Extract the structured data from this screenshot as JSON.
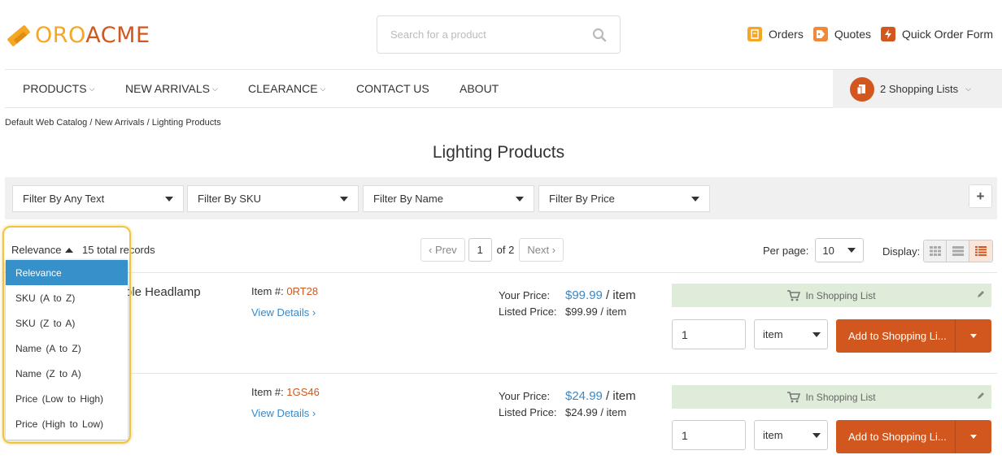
{
  "brand": {
    "part1": "ORO",
    "part2": "ACME",
    "color_orange": "#f5a623",
    "color_red": "#d2571e"
  },
  "search": {
    "placeholder": "Search for a product",
    "icon": "search-icon"
  },
  "top_links": [
    {
      "label": "Orders",
      "icon": "orders-icon",
      "color": "#f5a623"
    },
    {
      "label": "Quotes",
      "icon": "quotes-tag-icon",
      "color": "#f08a3a"
    },
    {
      "label": "Quick Order Form",
      "icon": "lightning-icon",
      "color": "#d2571e"
    }
  ],
  "nav": {
    "items": [
      "PRODUCTS",
      "NEW ARRIVALS",
      "CLEARANCE",
      "CONTACT US",
      "ABOUT"
    ],
    "shopping_lists": "2 Shopping Lists"
  },
  "breadcrumb": "Default Web Catalog / New Arrivals / Lighting Products",
  "page_title": "Lighting Products",
  "filters": [
    "Filter By Any Text",
    "Filter By SKU",
    "Filter By Name",
    "Filter By Price"
  ],
  "toolbar": {
    "sort_label": "Relevance",
    "total": "15 total records",
    "prev": "‹ Prev",
    "page": "1",
    "of_pages": "of 2",
    "next": "Next ›",
    "per_page_label": "Per page:",
    "per_page": "10",
    "display_label": "Display:"
  },
  "sort_options": [
    "Relevance",
    "SKU  (A to Z)",
    "SKU  (Z to A)",
    "Name  (A to Z)",
    "Name  (Z to A)",
    "Price  (Low to High)",
    "Price  (High to Low)"
  ],
  "products": [
    {
      "name_visible": "ble Headlamp",
      "item_label": "Item #: ",
      "sku": "0RT28",
      "details": "View Details ›",
      "your_price_label": "Your Price:",
      "your_price": "$99.99",
      "your_unit": " / item",
      "listed_label": "Listed Price:",
      "listed_price": "$99.99 / item",
      "in_list": "In Shopping List",
      "qty": "1",
      "unit": "item",
      "add_label": "Add to Shopping Li..."
    },
    {
      "name_visible": "",
      "item_label": "Item #: ",
      "sku": "1GS46",
      "details": "View Details ›",
      "your_price_label": "Your Price:",
      "your_price": "$24.99",
      "your_unit": " / item",
      "listed_label": "Listed Price:",
      "listed_price": "$24.99 / item",
      "in_list": "In Shopping List",
      "qty": "1",
      "unit": "item",
      "add_label": "Add to Shopping Li..."
    }
  ]
}
